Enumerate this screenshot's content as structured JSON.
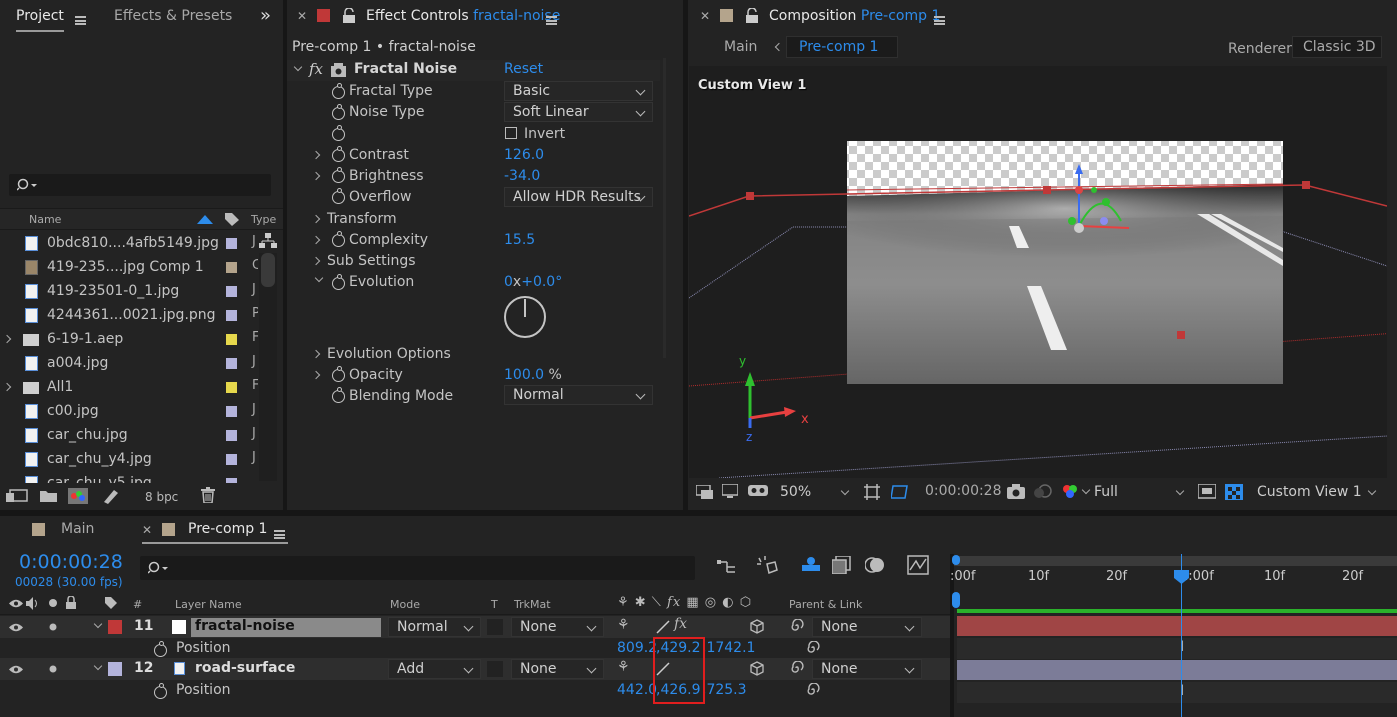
{
  "project_panel": {
    "tabs": [
      "Project",
      "Effects & Presets"
    ],
    "expand_glyph": "»",
    "columns": {
      "name": "Name",
      "type": "Type"
    },
    "files": [
      {
        "name": "0bdc810....4afb5149.jpg",
        "label_color": "#b4b4dc",
        "type": "J"
      },
      {
        "name": "419-235....jpg Comp 1",
        "label_color": "#b4a48c",
        "type": "C"
      },
      {
        "name": "419-23501-0_1.jpg",
        "label_color": "#b4b4dc",
        "type": "J"
      },
      {
        "name": "4244361...0021.jpg.png",
        "label_color": "#b4b4dc",
        "type": "P"
      },
      {
        "name": "6-19-1.aep",
        "label_color": "#e6d84c",
        "type": "F"
      },
      {
        "name": "a004.jpg",
        "label_color": "#b4b4dc",
        "type": "J"
      },
      {
        "name": "All1",
        "label_color": "#e6d84c",
        "type": "F"
      },
      {
        "name": "c00.jpg",
        "label_color": "#b4b4dc",
        "type": "J"
      },
      {
        "name": "car_chu.jpg",
        "label_color": "#b4b4dc",
        "type": "J"
      },
      {
        "name": "car_chu_y4.jpg",
        "label_color": "#b4b4dc",
        "type": "J"
      },
      {
        "name": "car_chu_y5.jpg",
        "label_color": "#b4b4dc",
        "type": "J"
      }
    ],
    "bpc": "8 bpc"
  },
  "effect_controls": {
    "tab_label": "Effect Controls",
    "tab_target": "fractal-noise",
    "header": "Pre-comp 1 • fractal-noise",
    "effect_name": "Fractal Noise",
    "reset": "Reset",
    "params": {
      "fractal_type": {
        "label": "Fractal Type",
        "value": "Basic"
      },
      "noise_type": {
        "label": "Noise Type",
        "value": "Soft Linear"
      },
      "invert": {
        "label": "Invert",
        "checked": false
      },
      "contrast": {
        "label": "Contrast",
        "value": "126.0"
      },
      "brightness": {
        "label": "Brightness",
        "value": "-34.0"
      },
      "overflow": {
        "label": "Overflow",
        "value": "Allow HDR Results"
      },
      "transform": {
        "label": "Transform"
      },
      "complexity": {
        "label": "Complexity",
        "value": "15.5"
      },
      "sub_settings": {
        "label": "Sub Settings"
      },
      "evolution": {
        "label": "Evolution",
        "revolutions": "0",
        "x_sep": "x",
        "degrees": "+0.0°"
      },
      "evolution_options": {
        "label": "Evolution Options"
      },
      "opacity": {
        "label": "Opacity",
        "value": "100.0",
        "unit": "%"
      },
      "blending_mode": {
        "label": "Blending Mode",
        "value": "Normal"
      }
    }
  },
  "composition": {
    "tab_label": "Composition",
    "tab_target": "Pre-comp 1",
    "breadcrumbs": [
      "Main",
      "Pre-comp 1"
    ],
    "renderer_label": "Renderer:",
    "renderer_value": "Classic 3D",
    "view_label": "Custom View 1",
    "axis_labels": {
      "x": "x",
      "y": "y",
      "z": "z"
    },
    "footer": {
      "zoom": "50%",
      "timecode": "0:00:00:28",
      "resolution": "Full",
      "view": "Custom View 1"
    }
  },
  "timeline": {
    "tabs": [
      "Main",
      "Pre-comp 1"
    ],
    "timecode": "0:00:00:28",
    "frame_info": "00028 (30.00 fps)",
    "columns": {
      "hash": "#",
      "layer_name": "Layer Name",
      "mode": "Mode",
      "t": "T",
      "trkmat": "TrkMat",
      "parent": "Parent & Link"
    },
    "ruler": [
      ":00f",
      "10f",
      "20f",
      "1:00f",
      "10f",
      "20f"
    ],
    "layers": [
      {
        "index": "11",
        "name": "fractal-noise",
        "label_color": "#c03838",
        "mode": "Normal",
        "trkmat": "None",
        "parent": "None",
        "position": {
          "label": "Position",
          "x": "809.2",
          "y": "429.2",
          "z": "1742.1"
        }
      },
      {
        "index": "12",
        "name": "road-surface",
        "label_color": "#b4b4dc",
        "mode": "Add",
        "trkmat": "None",
        "parent": "None",
        "position": {
          "label": "Position",
          "x": "442.0",
          "y": "426.9",
          "z": "725.3"
        }
      }
    ]
  }
}
